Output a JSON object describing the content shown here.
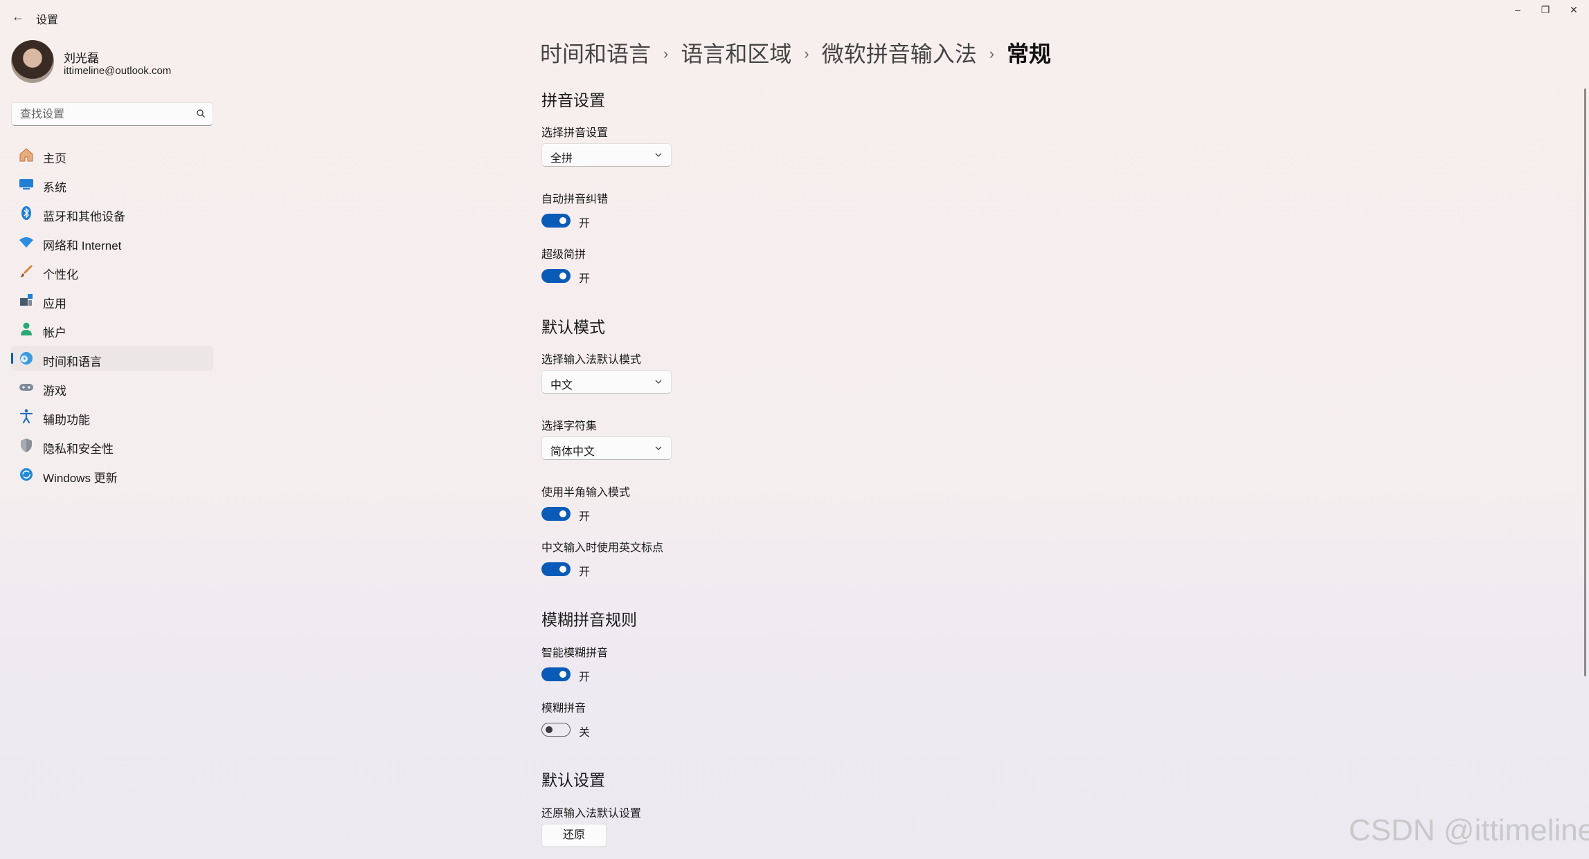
{
  "window": {
    "title": "设置",
    "back": "←",
    "minimize": "–",
    "maximize": "❐",
    "close": "✕"
  },
  "profile": {
    "name": "刘光磊",
    "email": "ittimeline@outlook.com"
  },
  "search": {
    "placeholder": "查找设置"
  },
  "sidebar": {
    "items": [
      {
        "label": "主页",
        "icon": "home-icon"
      },
      {
        "label": "系统",
        "icon": "system-icon"
      },
      {
        "label": "蓝牙和其他设备",
        "icon": "bluetooth-icon"
      },
      {
        "label": "网络和 Internet",
        "icon": "network-icon"
      },
      {
        "label": "个性化",
        "icon": "brush-icon"
      },
      {
        "label": "应用",
        "icon": "apps-icon"
      },
      {
        "label": "帐户",
        "icon": "account-icon"
      },
      {
        "label": "时间和语言",
        "icon": "time-language-icon",
        "active": true
      },
      {
        "label": "游戏",
        "icon": "gaming-icon"
      },
      {
        "label": "辅助功能",
        "icon": "accessibility-icon"
      },
      {
        "label": "隐私和安全性",
        "icon": "shield-icon"
      },
      {
        "label": "Windows 更新",
        "icon": "update-icon"
      }
    ]
  },
  "breadcrumb": {
    "items": [
      "时间和语言",
      "语言和区域",
      "微软拼音输入法"
    ],
    "current": "常规",
    "separator": "›"
  },
  "sections": {
    "pinyin": {
      "title": "拼音设置",
      "choose_label": "选择拼音设置",
      "choose_value": "全拼",
      "autocorrect_label": "自动拼音纠错",
      "autocorrect_state": "开",
      "super_short_label": "超级简拼",
      "super_short_state": "开"
    },
    "default_mode": {
      "title": "默认模式",
      "mode_label": "选择输入法默认模式",
      "mode_value": "中文",
      "charset_label": "选择字符集",
      "charset_value": "简体中文",
      "halfwidth_label": "使用半角输入模式",
      "halfwidth_state": "开",
      "en_punct_label": "中文输入时使用英文标点",
      "en_punct_state": "开"
    },
    "fuzzy": {
      "title": "模糊拼音规则",
      "smart_label": "智能模糊拼音",
      "smart_state": "开",
      "fuzzy_label": "模糊拼音",
      "fuzzy_state": "关"
    },
    "defaults": {
      "title": "默认设置",
      "restore_label": "还原输入法默认设置",
      "restore_button": "还原"
    }
  },
  "watermark": "CSDN @ittimeline",
  "colors": {
    "accent": "#0a5bb8",
    "background": "#f6efee"
  }
}
